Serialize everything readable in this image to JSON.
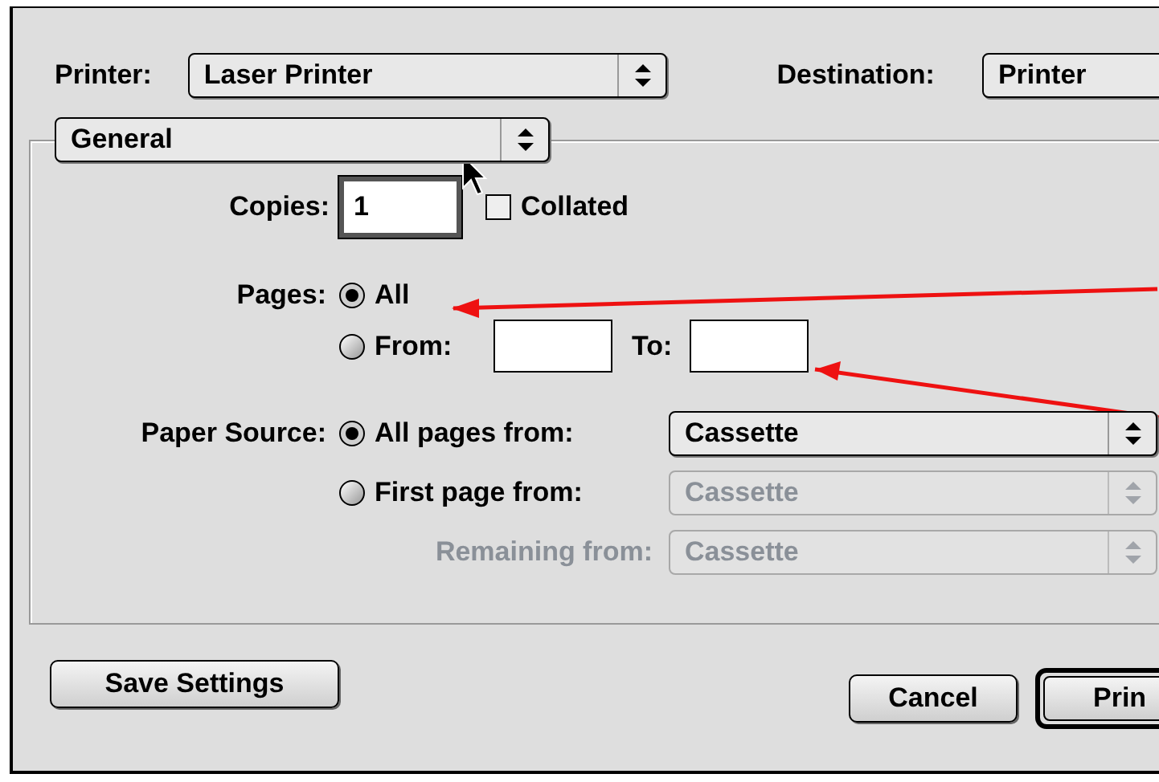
{
  "printer": {
    "label": "Printer:",
    "value": "Laser Printer"
  },
  "destination": {
    "label": "Destination:",
    "value": "Printer"
  },
  "panel": {
    "value": "General"
  },
  "copies": {
    "label": "Copies:",
    "value": "1"
  },
  "collated": {
    "label": "Collated",
    "checked": false
  },
  "pages": {
    "label": "Pages:",
    "options": [
      {
        "label": "All",
        "selected": true
      },
      {
        "label": "From:",
        "selected": false
      }
    ],
    "to_label": "To:"
  },
  "paper_source": {
    "label": "Paper Source:",
    "options": [
      {
        "label": "All pages from:",
        "selected": true,
        "value": "Cassette",
        "disabled": false
      },
      {
        "label": "First page from:",
        "selected": false,
        "value": "Cassette",
        "disabled": true
      }
    ],
    "remaining": {
      "label": "Remaining from:",
      "value": "Cassette",
      "disabled": true
    }
  },
  "save_button": {
    "label": "Save Settings"
  },
  "buttons": [
    {
      "label": "Cancel",
      "kind": "plain"
    },
    {
      "label": "Prin",
      "kind": "default"
    }
  ]
}
